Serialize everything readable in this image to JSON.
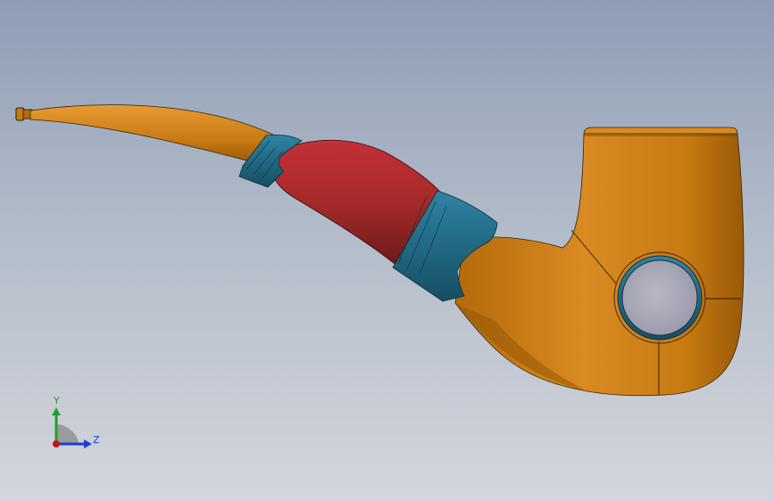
{
  "viewport": {
    "model": "tobacco-pipe",
    "background_top": "#8e9db4",
    "background_bottom": "#d3d6dc"
  },
  "colors": {
    "bowl_orange": "#c77a12",
    "shank_red": "#a52a2a",
    "ring_blue": "#1f6a85",
    "insert_gray": "#a9a9b8"
  },
  "triad": {
    "y_label": "Y",
    "z_label": "Z",
    "y_color": "#1aa32a",
    "z_color": "#1a3fd6",
    "origin_color": "#c81414"
  }
}
